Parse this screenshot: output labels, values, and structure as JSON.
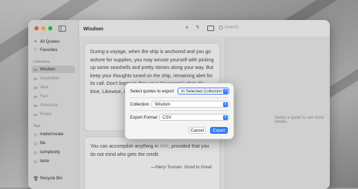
{
  "sidebar": {
    "all_quotes": "All Quotes",
    "favorites": "Favorites",
    "collections_heading": "Collections",
    "collections": [
      "Wisdom",
      "Inspiration",
      "Idea",
      "Fact",
      "Anecdote",
      "Poetic"
    ],
    "tags_heading": "Tags",
    "tags": [
      "make/create",
      "life",
      "complexity",
      "taste"
    ],
    "recycle_bin": "Recycle Bin"
  },
  "toolbar": {
    "title": "Wisdom",
    "search_placeholder": "Search"
  },
  "quotes": [
    {
      "text": "During a voyage, when the ship is anchored and you go ashore for supplies, you may amuse yourself with picking up some seashells and pretty stones along your way. But keep your thoughts tuned on the ship, remaining alert for its call. Don't linger to drop your \"treasures\" when it's time. Likewise, in life... your mission, a..."
    },
    {
      "text_before": "You can accomplish anything in ",
      "tag": "#life",
      "text_after": ", provided that you do not mind who gets the credit.",
      "attribution": "—Harry Truman. Good to Great."
    }
  ],
  "detail": {
    "empty_message": "Select a quote to see more details."
  },
  "dialog": {
    "select_label": "Select quotes to export",
    "select_value": "In Selected Collection",
    "collection_label": "Collection",
    "collection_value": "Wisdom",
    "format_label": "Export Format",
    "format_value": "CSV",
    "cancel_label": "Cancel",
    "export_label": "Export"
  },
  "colors": {
    "accent": "#2f7df6",
    "close": "#ff5f57",
    "minimize": "#febc2e",
    "zoom": "#28c840"
  }
}
